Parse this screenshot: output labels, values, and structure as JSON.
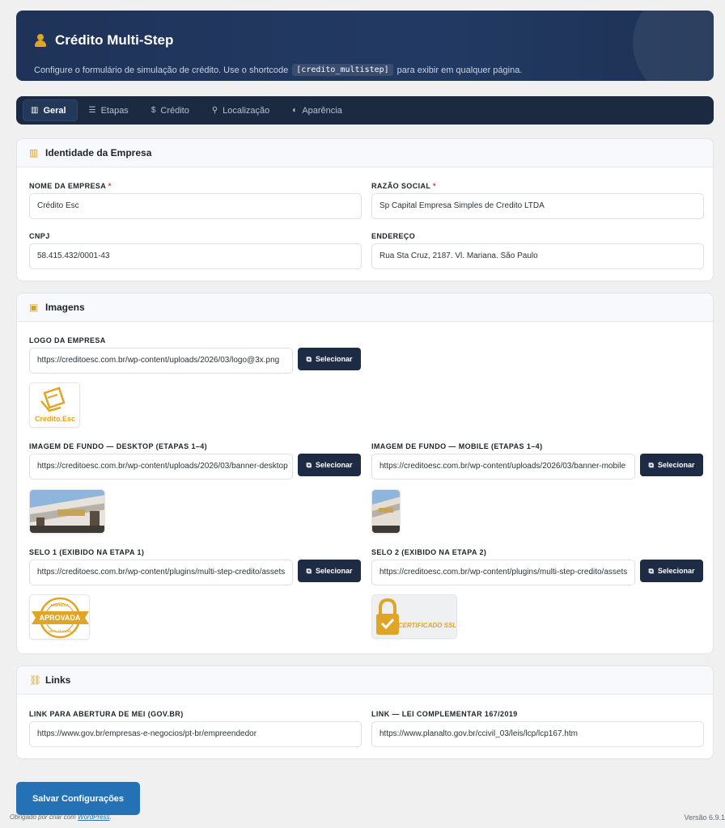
{
  "header": {
    "title": "Crédito Multi-Step",
    "icon": "user-icon",
    "description_before": "Configure o formulário de simulação de crédito. Use o shortcode",
    "shortcode": "[credito_multistep]",
    "description_after": "para exibir em qualquer página."
  },
  "tabs": [
    {
      "label": "Geral",
      "icon": "building-icon",
      "active": true
    },
    {
      "label": "Etapas",
      "icon": "list-icon",
      "active": false
    },
    {
      "label": "Crédito",
      "icon": "dollar-icon",
      "active": false
    },
    {
      "label": "Localização",
      "icon": "pin-icon",
      "active": false
    },
    {
      "label": "Aparência",
      "icon": "palette-icon",
      "active": false
    }
  ],
  "identity": {
    "title": "Identidade da Empresa",
    "company_name": {
      "label": "NOME DA EMPRESA",
      "required": "*",
      "value": "Crédito Esc"
    },
    "legal_name": {
      "label": "RAZÃO SOCIAL",
      "required": "*",
      "value": "Sp Capital Empresa Simples de Credito LTDA"
    },
    "cnpj": {
      "label": "CNPJ",
      "value": "58.415.432/0001-43"
    },
    "address": {
      "label": "ENDEREÇO",
      "value": "Rua Sta Cruz, 2187. Vl. Mariana. São Paulo"
    }
  },
  "images": {
    "title": "Imagens",
    "select_label": "Selecionar",
    "logo": {
      "label": "LOGO DA EMPRESA",
      "value": "https://creditoesc.com.br/wp-content/uploads/2026/03/logo@3x.png",
      "preview_text": "Credito.Esc"
    },
    "bg_desktop": {
      "label": "IMAGEM DE FUNDO — DESKTOP (ETAPAS 1–4)",
      "value": "https://creditoesc.com.br/wp-content/uploads/2026/03/banner-desktop"
    },
    "bg_mobile": {
      "label": "IMAGEM DE FUNDO — MOBILE (ETAPAS 1–4)",
      "value": "https://creditoesc.com.br/wp-content/uploads/2026/03/banner-mobile"
    },
    "seal1": {
      "label": "SELO 1 (EXIBIDO NA ETAPA 1)",
      "value": "https://creditoesc.com.br/wp-content/plugins/multi-step-credito/assets",
      "preview_text": "APROVADA",
      "preview_top": "EMPRESA",
      "preview_bottom": "100% SEGURA"
    },
    "seal2": {
      "label": "SELO 2 (EXIBIDO NA ETAPA 2)",
      "value": "https://creditoesc.com.br/wp-content/plugins/multi-step-credito/assets",
      "preview_text": "CERTIFICADO SSL"
    }
  },
  "links": {
    "title": "Links",
    "mei": {
      "label": "LINK PARA ABERTURA DE MEI (GOV.BR)",
      "value": "https://www.gov.br/empresas-e-negocios/pt-br/empreendedor"
    },
    "lc": {
      "label": "LINK — LEI COMPLEMENTAR 167/2019",
      "value": "https://www.planalto.gov.br/ccivil_03/leis/lcp/lcp167.htm"
    }
  },
  "save_label": "Salvar Configurações",
  "footer": {
    "thanks": "Obrigado por criar com",
    "wp": "WordPress",
    "version": "Versão 6.9.1"
  },
  "colors": {
    "accent": "#2471b5",
    "navy": "#1d2b45",
    "gold": "#e0a526"
  }
}
